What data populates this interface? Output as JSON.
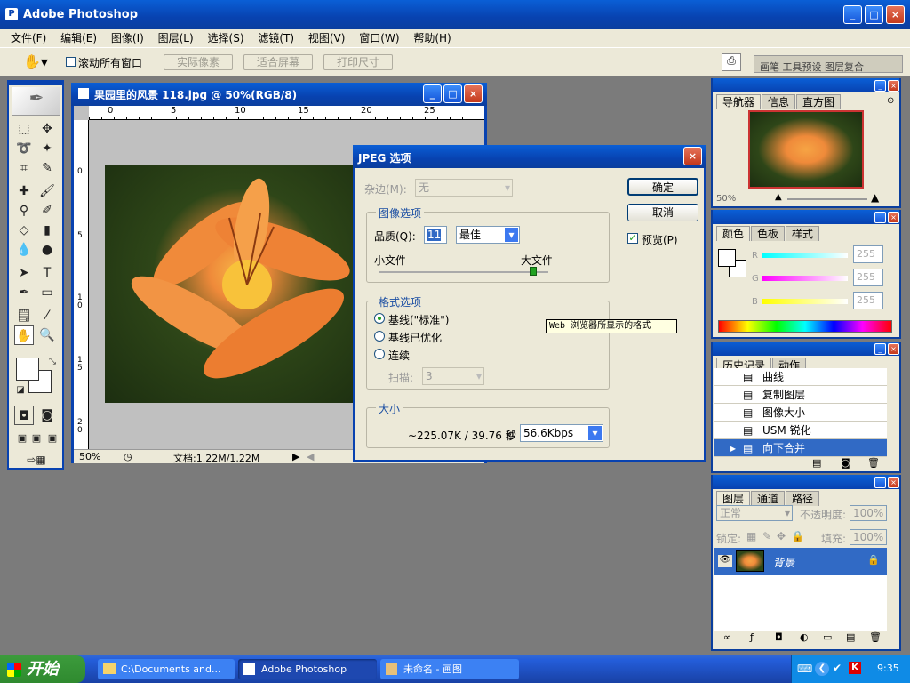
{
  "app": {
    "title": "Adobe Photoshop"
  },
  "menu": [
    "文件(F)",
    "编辑(E)",
    "图像(I)",
    "图层(L)",
    "选择(S)",
    "滤镜(T)",
    "视图(V)",
    "窗口(W)",
    "帮助(H)"
  ],
  "options": {
    "scroll_all": "滚动所有窗口",
    "actual_pixels": "实际像素",
    "fit_screen": "适合屏幕",
    "print_size": "打印尺寸",
    "well_tabs": [
      "画笔",
      "工具预设",
      "图层复合"
    ]
  },
  "document": {
    "title": "果园里的风景 118.jpg @ 50%(RGB/8)",
    "zoom": "50%",
    "doc_info": "文档:1.22M/1.22M",
    "ruler_h": [
      "0",
      "5",
      "10",
      "15",
      "20",
      "25"
    ],
    "ruler_v": [
      "0",
      "5",
      "1 0",
      "1 5",
      "2 0"
    ]
  },
  "dialog": {
    "title": "JPEG 选项",
    "matte_label": "杂边(M):",
    "matte_value": "无",
    "image_options_label": "图像选项",
    "quality_label": "品质(Q):",
    "quality_value": "11",
    "quality_preset": "最佳",
    "small_file": "小文件",
    "large_file": "大文件",
    "format_options_label": "格式选项",
    "baseline_standard": "基线(\"标准\")",
    "baseline_optimized": "基线已优化",
    "progressive": "连续",
    "scans_label": "扫描:",
    "scans_value": "3",
    "tooltip": "Web 浏览器所显示的格式",
    "size_label": "大小",
    "size_value": "~225.07K / 39.76 秒",
    "at": "@",
    "speed": "56.6Kbps",
    "ok": "确定",
    "cancel": "取消",
    "preview": "预览(P)"
  },
  "navigator": {
    "tabs": [
      "导航器",
      "信息",
      "直方图"
    ],
    "zoom": "50%"
  },
  "color": {
    "tabs": [
      "颜色",
      "色板",
      "样式"
    ],
    "r_label": "R",
    "g_label": "G",
    "b_label": "B",
    "r": "255",
    "g": "255",
    "b": "255"
  },
  "history": {
    "tabs": [
      "历史记录",
      "动作"
    ],
    "items": [
      "曲线",
      "复制图层",
      "图像大小",
      "USM 锐化",
      "向下合并"
    ]
  },
  "layers": {
    "tabs": [
      "图层",
      "通道",
      "路径"
    ],
    "blend_mode": "正常",
    "opacity_label": "不透明度:",
    "opacity": "100%",
    "lock_label": "锁定:",
    "fill_label": "填充:",
    "fill": "100%",
    "layer_name": "背景"
  },
  "taskbar": {
    "start": "开始",
    "tasks": [
      "C:\\Documents and...",
      "Adobe Photoshop",
      "未命名 - 画图"
    ],
    "time": "9:35"
  }
}
